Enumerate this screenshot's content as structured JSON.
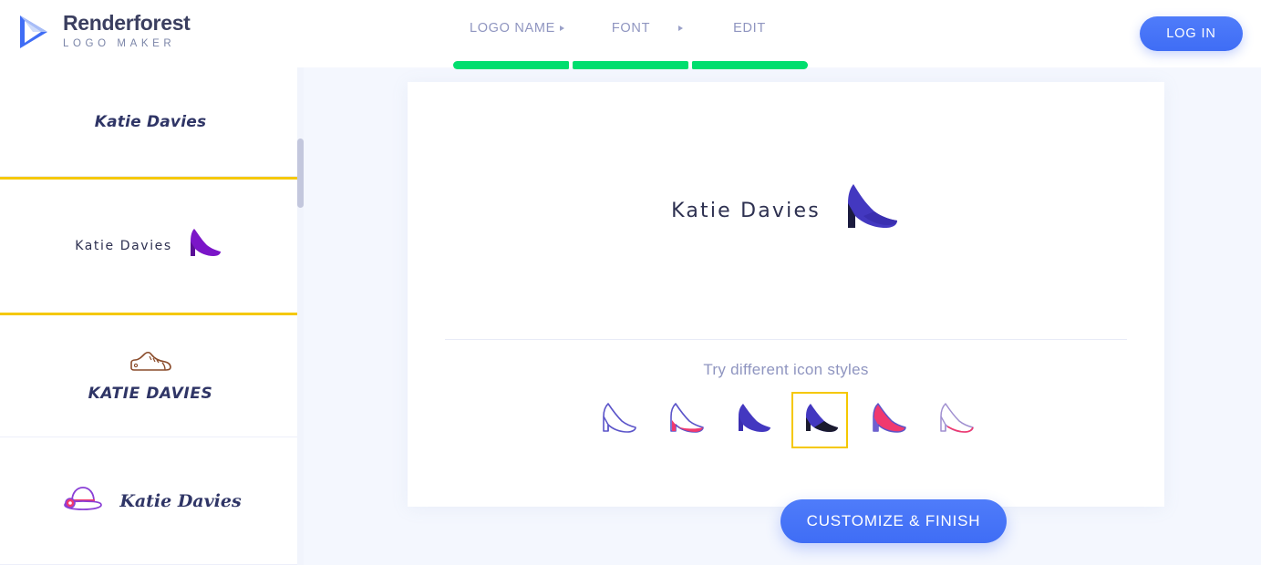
{
  "brand": {
    "logo_icon": "play-triangle-icon",
    "name": "Renderforest",
    "subtitle": "LOGO MAKER",
    "accent": "#3f6df5"
  },
  "nav": {
    "items": [
      {
        "label": "LOGO NAME",
        "has_arrow": true,
        "arrow_icon": "caret-right-icon"
      },
      {
        "label": "FONT",
        "has_arrow": true,
        "arrow_icon": "caret-right-icon"
      },
      {
        "label": "EDIT",
        "has_arrow": false,
        "arrow_icon": ""
      }
    ],
    "progress_color": "#00de6e",
    "progress_steps": 3
  },
  "header": {
    "login_label": "LOG IN"
  },
  "sidebar": {
    "scroll_thumb": true,
    "items": [
      {
        "name": "Katie Davies",
        "style": "bold-italic",
        "icon": "none",
        "selected": false,
        "layout": "text-only"
      },
      {
        "name": "Katie Davies",
        "style": "handwritten",
        "icon": "high-heel-icon",
        "icon_color": "#7b15c8",
        "selected": true,
        "layout": "text-left-icon-right"
      },
      {
        "name": "KATIE DAVIES",
        "style": "small-caps-bold-italic",
        "icon": "sneaker-icon",
        "icon_color": "#8a4b2a",
        "selected": false,
        "layout": "icon-top-text-bottom"
      },
      {
        "name": "Katie Davies",
        "style": "script",
        "icon": "hat-icon",
        "icon_color": "#8a3fd6",
        "icon_accent": "#f0396f",
        "selected": false,
        "layout": "icon-left-text-right"
      }
    ]
  },
  "main": {
    "preview": {
      "name": "Katie Davies",
      "icon": "high-heel-icon",
      "icon_color": "#4338c0"
    },
    "styles_title": "Try different icon styles",
    "selected_style_index": 3,
    "selection_color": "#f5c800",
    "icon_styles": [
      {
        "name": "high-heel-outline-icon",
        "fill": "none",
        "stroke": "#5b54c9",
        "accent": "none"
      },
      {
        "name": "high-heel-outline-pink-fill-icon",
        "fill": "#f0396f",
        "stroke": "#5b54c9",
        "accent": "#f0396f"
      },
      {
        "name": "high-heel-solid-blue-icon",
        "fill": "#4338c0",
        "stroke": "#4338c0",
        "accent": "none"
      },
      {
        "name": "high-heel-solid-blue-black-heel-icon",
        "fill": "#4338c0",
        "stroke": "#4338c0",
        "accent": "#1b1b2e"
      },
      {
        "name": "high-heel-pink-fill-icon",
        "fill": "#f0396f",
        "stroke": "#5b54c9",
        "accent": "#f0396f"
      },
      {
        "name": "high-heel-light-pink-outline-icon",
        "fill": "none",
        "stroke": "#a08fd0",
        "accent": "#f0396f"
      }
    ],
    "finish_label": "CUSTOMIZE & FINISH"
  }
}
